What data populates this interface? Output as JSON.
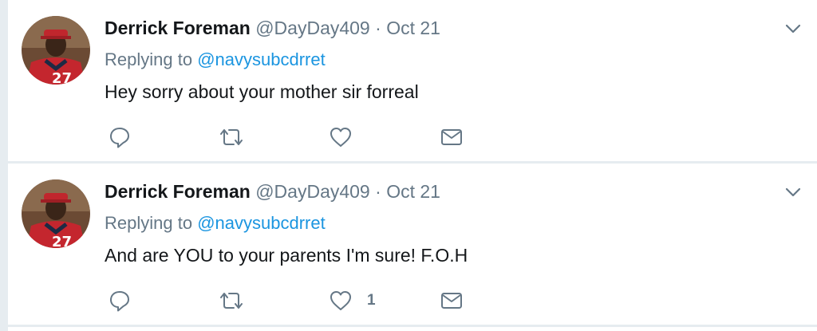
{
  "tweets": [
    {
      "author_name": "Derrick Foreman",
      "handle": "@DayDay409",
      "separator": "·",
      "date": "Oct 21",
      "replying_label": "Replying to",
      "replying_to": "@navysubcdrret",
      "text": "Hey sorry about your mother sir forreal",
      "like_count": ""
    },
    {
      "author_name": "Derrick Foreman",
      "handle": "@DayDay409",
      "separator": "·",
      "date": "Oct 21",
      "replying_label": "Replying to",
      "replying_to": "@navysubcdrret",
      "text": "And are YOU to your parents I'm sure! F.O.H",
      "like_count": "1"
    }
  ],
  "icons": {
    "reply": "reply-icon",
    "retweet": "retweet-icon",
    "like": "heart-icon",
    "dm": "mail-icon",
    "caret": "chevron-down-icon"
  },
  "colors": {
    "link": "#1b95e0",
    "secondary": "#657786",
    "divider": "#e6ecf0"
  }
}
